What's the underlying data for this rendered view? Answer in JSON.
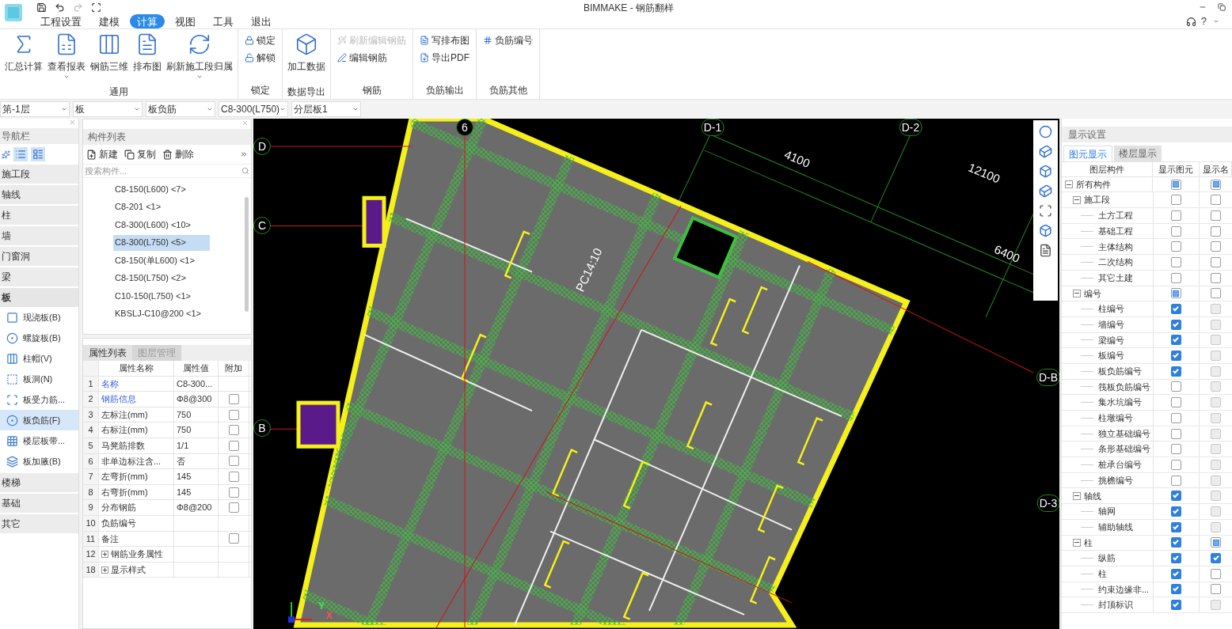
{
  "window": {
    "title": "BIMMAKE - 钢筋翻样"
  },
  "menu_tabs": [
    {
      "label": "工程设置",
      "selected": false
    },
    {
      "label": "建模",
      "selected": false
    },
    {
      "label": "计算",
      "selected": true
    },
    {
      "label": "视图",
      "selected": false
    },
    {
      "label": "工具",
      "selected": false
    },
    {
      "label": "退出",
      "selected": false
    }
  ],
  "help": {
    "label": "?"
  },
  "ribbon": [
    {
      "label": "通用",
      "kind": "large",
      "buttons": [
        {
          "label": "汇总计算",
          "dropdown": false
        },
        {
          "label": "查看报表",
          "dropdown": true
        },
        {
          "label": "钢筋三维",
          "dropdown": false
        },
        {
          "label": "排布图",
          "dropdown": false
        },
        {
          "label": "刷新施工段归属",
          "dropdown": true
        }
      ]
    },
    {
      "label": "锁定",
      "kind": "small",
      "buttons": [
        {
          "label": "锁定",
          "disabled": false
        },
        {
          "label": "解锁",
          "disabled": false
        }
      ]
    },
    {
      "label": "数据导出",
      "kind": "large",
      "buttons": [
        {
          "label": "加工数据",
          "dropdown": false
        }
      ]
    },
    {
      "label": "钢筋",
      "kind": "small",
      "buttons": [
        {
          "label": "刷新编辑钢筋",
          "disabled": true
        },
        {
          "label": "编辑钢筋",
          "disabled": false
        }
      ]
    },
    {
      "label": "负筋输出",
      "kind": "small",
      "buttons": [
        {
          "label": "写排布图",
          "disabled": false
        },
        {
          "label": "导出PDF",
          "disabled": false
        }
      ]
    },
    {
      "label": "负筋其他",
      "kind": "small",
      "buttons": [
        {
          "label": "负筋编号",
          "disabled": false
        }
      ]
    }
  ],
  "selectors": [
    "第-1层",
    "板",
    "板负筋",
    "C8-300(L750)",
    "分层板1"
  ],
  "navigator": {
    "title": "导航栏",
    "categories": [
      {
        "label": "施工段",
        "expanded": false
      },
      {
        "label": "轴线",
        "expanded": false
      },
      {
        "label": "柱",
        "expanded": false
      },
      {
        "label": "墙",
        "expanded": false
      },
      {
        "label": "门窗洞",
        "expanded": false
      },
      {
        "label": "梁",
        "expanded": false
      },
      {
        "label": "板",
        "expanded": true,
        "children": [
          {
            "label": "现浇板(B)",
            "selected": false
          },
          {
            "label": "螺旋板(B)",
            "selected": false
          },
          {
            "label": "柱帽(V)",
            "selected": false
          },
          {
            "label": "板洞(N)",
            "selected": false
          },
          {
            "label": "板受力筋...",
            "selected": false
          },
          {
            "label": "板负筋(F)",
            "selected": true
          },
          {
            "label": "楼层板带...",
            "selected": false
          },
          {
            "label": "板加腋(B)",
            "selected": false
          }
        ]
      },
      {
        "label": "楼梯",
        "expanded": false
      },
      {
        "label": "基础",
        "expanded": false
      },
      {
        "label": "其它",
        "expanded": false
      }
    ]
  },
  "component_list": {
    "title": "构件列表",
    "actions": [
      "新建",
      "复制",
      "删除"
    ],
    "search": {
      "placeholder": "搜索构件..."
    },
    "items": [
      {
        "label": "C8-150(L600) <7>",
        "selected": false
      },
      {
        "label": "C8-201 <1>",
        "selected": false
      },
      {
        "label": "C8-300(L600) <10>",
        "selected": false
      },
      {
        "label": "C8-300(L750) <5>",
        "selected": true
      },
      {
        "label": "C8-150(单L600) <1>",
        "selected": false
      },
      {
        "label": "C8-150(L750) <2>",
        "selected": false
      },
      {
        "label": "C10-150(L750) <1>",
        "selected": false
      },
      {
        "label": "KBSLJ-C10@200 <1>",
        "selected": false
      }
    ]
  },
  "properties": {
    "tabs": [
      {
        "label": "属性列表",
        "selected": true
      },
      {
        "label": "图层管理",
        "selected": false
      }
    ],
    "columns": [
      "属性名称",
      "属性值",
      "附加"
    ],
    "rows": [
      {
        "num": "1",
        "name": "名称",
        "value": "C8-300...",
        "highlight": true,
        "has_checkbox": false
      },
      {
        "num": "2",
        "name": "钢筋信息",
        "value": "Φ8@300",
        "highlight": true,
        "has_checkbox": true,
        "checked": false
      },
      {
        "num": "3",
        "name": "左标注(mm)",
        "value": "750",
        "highlight": false,
        "has_checkbox": true,
        "checked": false
      },
      {
        "num": "4",
        "name": "右标注(mm)",
        "value": "750",
        "highlight": false,
        "has_checkbox": true,
        "checked": false
      },
      {
        "num": "5",
        "name": "马凳筋排数",
        "value": "1/1",
        "highlight": false,
        "has_checkbox": true,
        "checked": false
      },
      {
        "num": "6",
        "name": "非单边标注含...",
        "value": "否",
        "highlight": false,
        "has_checkbox": true,
        "checked": false
      },
      {
        "num": "7",
        "name": "左弯折(mm)",
        "value": "145",
        "highlight": false,
        "has_checkbox": true,
        "checked": false
      },
      {
        "num": "8",
        "name": "右弯折(mm)",
        "value": "145",
        "highlight": false,
        "has_checkbox": true,
        "checked": false
      },
      {
        "num": "9",
        "name": "分布钢筋",
        "value": "Φ8@200",
        "highlight": false,
        "has_checkbox": true,
        "checked": false
      },
      {
        "num": "10",
        "name": "负筋编号",
        "highlight": false,
        "has_checkbox": false
      },
      {
        "num": "11",
        "name": "备注",
        "highlight": false,
        "has_checkbox": true,
        "checked": false
      },
      {
        "num": "12",
        "name": "钢筋业务属性",
        "highlight": false,
        "has_checkbox": false,
        "expandable": true
      },
      {
        "num": "18",
        "name": "显示样式",
        "highlight": false,
        "has_checkbox": false,
        "expandable": true
      }
    ]
  },
  "canvas": {
    "labels": [
      {
        "text": "D",
        "kind": "axis"
      },
      {
        "text": "C",
        "kind": "axis"
      },
      {
        "text": "B",
        "kind": "axis"
      },
      {
        "text": "6",
        "kind": "axis"
      },
      {
        "text": "D-1",
        "kind": "axis"
      },
      {
        "text": "D-2",
        "kind": "axis"
      },
      {
        "text": "D-B",
        "kind": "axis"
      },
      {
        "text": "D-3",
        "kind": "axis"
      },
      {
        "text": "4100",
        "kind": "dimension"
      },
      {
        "text": "12100",
        "kind": "dimension"
      },
      {
        "text": "6400",
        "kind": "dimension"
      },
      {
        "text": "PC14:10",
        "kind": "tag"
      }
    ],
    "axis_x": "X",
    "axis_y": "Y"
  },
  "display_settings": {
    "title": "显示设置",
    "tabs": [
      {
        "label": "图元显示",
        "selected": true
      },
      {
        "label": "楼层显示",
        "selected": false
      }
    ],
    "columns": [
      "图层构件",
      "显示图元",
      "显示名"
    ],
    "tree": [
      {
        "label": "所有构件",
        "expanded": true,
        "show_element": false,
        "element_mixed": true,
        "show_name": false,
        "name_mixed": true,
        "name_disabled": false,
        "children": [
          {
            "label": "施工段",
            "expanded": true,
            "show_element": false,
            "element_mixed": false,
            "show_name": false,
            "name_mixed": false,
            "name_disabled": false,
            "children": [
              {
                "label": "土方工程",
                "show_element": false,
                "element_mixed": false,
                "show_name": false,
                "name_mixed": false,
                "name_disabled": false
              },
              {
                "label": "基础工程",
                "show_element": false,
                "element_mixed": false,
                "show_name": false,
                "name_mixed": false,
                "name_disabled": false
              },
              {
                "label": "主体结构",
                "show_element": false,
                "element_mixed": false,
                "show_name": false,
                "name_mixed": false,
                "name_disabled": false
              },
              {
                "label": "二次结构",
                "show_element": false,
                "element_mixed": false,
                "show_name": false,
                "name_mixed": false,
                "name_disabled": false
              },
              {
                "label": "其它土建",
                "show_element": false,
                "element_mixed": false,
                "show_name": false,
                "name_mixed": false,
                "name_disabled": false
              }
            ]
          },
          {
            "label": "编号",
            "expanded": true,
            "show_element": false,
            "element_mixed": true,
            "show_name": false,
            "name_mixed": false,
            "name_disabled": false,
            "children": [
              {
                "label": "柱编号",
                "show_element": true,
                "element_mixed": false,
                "show_name": false,
                "name_mixed": false,
                "name_disabled": true
              },
              {
                "label": "墙编号",
                "show_element": true,
                "element_mixed": false,
                "show_name": false,
                "name_mixed": false,
                "name_disabled": true
              },
              {
                "label": "梁编号",
                "show_element": true,
                "element_mixed": false,
                "show_name": false,
                "name_mixed": false,
                "name_disabled": true
              },
              {
                "label": "板编号",
                "show_element": true,
                "element_mixed": false,
                "show_name": false,
                "name_mixed": false,
                "name_disabled": true
              },
              {
                "label": "板负筋编号",
                "show_element": true,
                "element_mixed": false,
                "show_name": false,
                "name_mixed": false,
                "name_disabled": true
              },
              {
                "label": "筏板负筋编号",
                "show_element": false,
                "element_mixed": false,
                "show_name": false,
                "name_mixed": false,
                "name_disabled": true
              },
              {
                "label": "集水坑编号",
                "show_element": false,
                "element_mixed": false,
                "show_name": false,
                "name_mixed": false,
                "name_disabled": true
              },
              {
                "label": "柱墩编号",
                "show_element": false,
                "element_mixed": false,
                "show_name": false,
                "name_mixed": false,
                "name_disabled": true
              },
              {
                "label": "独立基础编号",
                "show_element": false,
                "element_mixed": false,
                "show_name": false,
                "name_mixed": false,
                "name_disabled": true
              },
              {
                "label": "条形基础编号",
                "show_element": false,
                "element_mixed": false,
                "show_name": false,
                "name_mixed": false,
                "name_disabled": true
              },
              {
                "label": "桩承台编号",
                "show_element": false,
                "element_mixed": false,
                "show_name": false,
                "name_mixed": false,
                "name_disabled": true
              },
              {
                "label": "挑檐编号",
                "show_element": false,
                "element_mixed": false,
                "show_name": false,
                "name_mixed": false,
                "name_disabled": true
              }
            ]
          },
          {
            "label": "轴线",
            "expanded": true,
            "show_element": true,
            "element_mixed": false,
            "show_name": false,
            "name_mixed": false,
            "name_disabled": true,
            "children": [
              {
                "label": "轴网",
                "show_element": true,
                "element_mixed": false,
                "show_name": false,
                "name_mixed": false,
                "name_disabled": true
              },
              {
                "label": "辅助轴线",
                "show_element": true,
                "element_mixed": false,
                "show_name": false,
                "name_mixed": false,
                "name_disabled": true
              }
            ]
          },
          {
            "label": "柱",
            "expanded": true,
            "show_element": true,
            "element_mixed": false,
            "show_name": false,
            "name_mixed": true,
            "name_disabled": false,
            "children": [
              {
                "label": "纵筋",
                "show_element": true,
                "element_mixed": false,
                "show_name": true,
                "name_mixed": false,
                "name_disabled": false
              },
              {
                "label": "柱",
                "show_element": true,
                "element_mixed": false,
                "show_name": false,
                "name_mixed": false,
                "name_disabled": false
              },
              {
                "label": "约束边缘非...",
                "show_element": true,
                "element_mixed": false,
                "show_name": false,
                "name_mixed": false,
                "name_disabled": false
              },
              {
                "label": "封顶标识",
                "show_element": true,
                "element_mixed": false,
                "show_name": false,
                "name_mixed": false,
                "name_disabled": true
              }
            ]
          }
        ]
      }
    ]
  }
}
